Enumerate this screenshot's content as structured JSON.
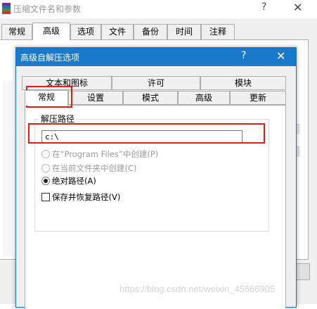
{
  "outer": {
    "title": "压缩文件名和参数",
    "help": "?",
    "close": "✕",
    "tabs": [
      "常规",
      "高级",
      "选项",
      "文件",
      "备份",
      "时间",
      "注释"
    ]
  },
  "inner": {
    "title": "高级自解压选项",
    "help": "?",
    "close": "✕",
    "tabs_row1": [
      "文本和图标",
      "许可",
      "模块"
    ],
    "tabs_row2": [
      "常规",
      "设置",
      "模式",
      "高级",
      "更新"
    ],
    "group_label": "解压路径",
    "path_value": "c:\\",
    "option_program_files": "在“Program Files”中创建(P)",
    "option_current_folder": "在当前文件夹中创建(C)",
    "option_absolute": "绝对路径(A)",
    "option_save_restore": "保存并恢复路径(V)"
  },
  "watermark": "https://blog.csdn.net/weixin_45666905",
  "colors": {
    "title_bar": "#1979ca",
    "annotation": "#e31b1b"
  }
}
